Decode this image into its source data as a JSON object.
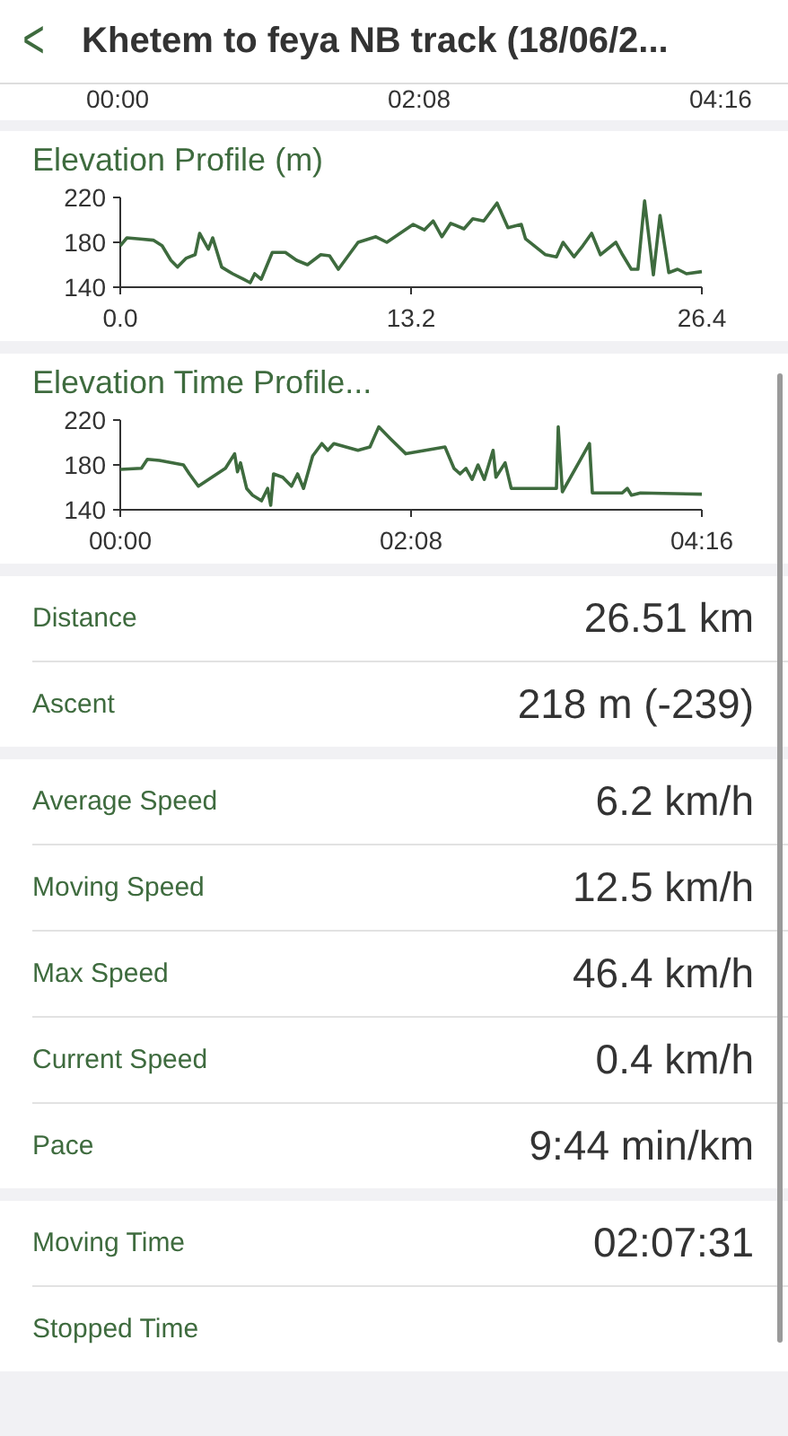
{
  "header": {
    "back": "<",
    "title": "Khetem to feya NB track  (18/06/2..."
  },
  "top_axis_labels": [
    "00:00",
    "02:08",
    "04:16"
  ],
  "charts": [
    {
      "title": "Elevation Profile (m)",
      "chart_data": {
        "type": "line",
        "xlim": [
          0,
          26.4
        ],
        "ylim": [
          140,
          220
        ],
        "xticks": [
          {
            "value": 0,
            "label": "0.0"
          },
          {
            "value": 13.2,
            "label": "13.2"
          },
          {
            "value": 26.4,
            "label": "26.4"
          }
        ],
        "yticks": [
          140,
          180,
          220
        ],
        "series": [
          {
            "color": "#3e6b3e",
            "x": [
              0,
              0.3,
              0.9,
              1.5,
              1.9,
              2.3,
              2.6,
              3.0,
              3.4,
              3.6,
              4.0,
              4.2,
              4.6,
              5.1,
              5.6,
              5.9,
              6.1,
              6.4,
              6.9,
              7.5,
              8.0,
              8.5,
              9.1,
              9.5,
              9.9,
              10.8,
              11.6,
              12.1,
              13.3,
              13.8,
              14.2,
              14.6,
              15.0,
              15.6,
              16.0,
              16.5,
              17.1,
              17.6,
              18.2,
              18.4,
              19.3,
              19.8,
              20.1,
              20.6,
              21.0,
              21.4,
              21.8,
              22.5,
              22.8,
              23.2,
              23.5,
              23.8,
              24.2,
              24.5,
              24.9,
              25.3,
              25.7,
              26.4
            ],
            "values": [
              177,
              184,
              183,
              182,
              177,
              164,
              158,
              166,
              169,
              188,
              174,
              184,
              158,
              152,
              147,
              144,
              152,
              147,
              171,
              171,
              164,
              160,
              169,
              168,
              156,
              180,
              185,
              180,
              196,
              191,
              199,
              185,
              197,
              192,
              201,
              199,
              215,
              193,
              196,
              183,
              169,
              167,
              180,
              167,
              177,
              188,
              169,
              180,
              169,
              156,
              156,
              217,
              151,
              204,
              153,
              156,
              152,
              154
            ]
          }
        ]
      }
    },
    {
      "title": "Elevation Time Profile...",
      "chart_data": {
        "type": "line",
        "xlim": [
          0,
          256
        ],
        "ylim": [
          140,
          220
        ],
        "xticks": [
          {
            "value": 0,
            "label": "00:00"
          },
          {
            "value": 128,
            "label": "02:08"
          },
          {
            "value": 256,
            "label": "04:16"
          }
        ],
        "yticks": [
          140,
          180,
          220
        ],
        "series": [
          {
            "color": "#3e6b3e",
            "x": [
              0,
              9.3,
              11.9,
              17.2,
              27.8,
              30.4,
              34.4,
              46.3,
              50.3,
              51.6,
              52.9,
              55.6,
              58.2,
              62.2,
              64.9,
              66.2,
              67.5,
              71.5,
              75.4,
              78.1,
              80.7,
              84.7,
              88.7,
              91.3,
              94,
              104.6,
              109.9,
              113.8,
              119.1,
              125.7,
              142.9,
              146.9,
              149.6,
              152.2,
              154.9,
              157.5,
              160.2,
              164.1,
              165.4,
              169.4,
              172.1,
              192,
              192.8,
              194.6,
              206.5,
              207.8,
              221,
              223.2,
              225,
              229,
              256
            ],
            "values": [
              176,
              177,
              185,
              184,
              180,
              172,
              161,
              177,
              190,
              174,
              182,
              159,
              153,
              148,
              159,
              144,
              172,
              169,
              161,
              172,
              159,
              188,
              199,
              193,
              199,
              193,
              196,
              214,
              203,
              190,
              196,
              177,
              172,
              177,
              167,
              180,
              167,
              193,
              169,
              182,
              159,
              159,
              214,
              156,
              199,
              155,
              155,
              159,
              153,
              155,
              154
            ]
          }
        ]
      }
    }
  ],
  "stat_groups": [
    [
      {
        "label": "Distance",
        "value": "26.51 km"
      },
      {
        "label": "Ascent",
        "value": "218 m (-239)"
      }
    ],
    [
      {
        "label": "Average Speed",
        "value": "6.2 km/h"
      },
      {
        "label": "Moving Speed",
        "value": "12.5 km/h"
      },
      {
        "label": "Max Speed",
        "value": "46.4 km/h"
      },
      {
        "label": "Current Speed",
        "value": "0.4 km/h"
      },
      {
        "label": "Pace",
        "value": "9:44 min/km"
      }
    ],
    [
      {
        "label": "Moving Time",
        "value": "02:07:31"
      },
      {
        "label": "Stopped Time"
      }
    ]
  ]
}
